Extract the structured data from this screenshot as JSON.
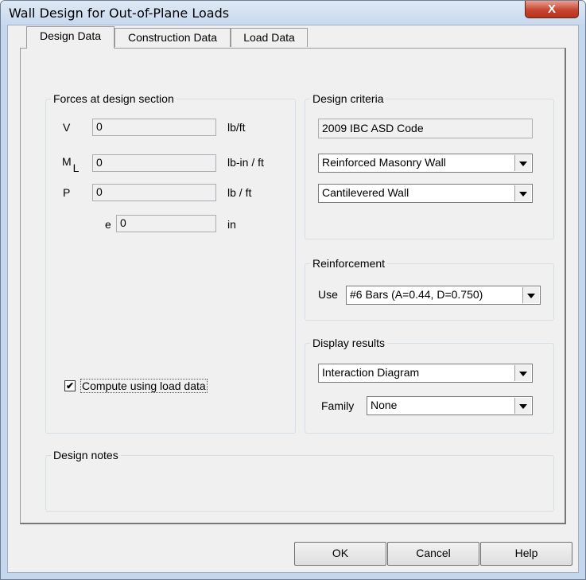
{
  "window": {
    "title": "Wall Design for Out-of-Plane Loads",
    "close_glyph": "X"
  },
  "tabs": [
    {
      "label": "Design Data",
      "active": true
    },
    {
      "label": "Construction Data",
      "active": false
    },
    {
      "label": "Load Data",
      "active": false
    }
  ],
  "forces": {
    "legend": "Forces at design section",
    "v": {
      "label": "V",
      "value": "0",
      "unit": "lb/ft"
    },
    "ml": {
      "label": "M",
      "sub": "L",
      "value": "0",
      "unit": "lb-in / ft"
    },
    "p": {
      "label": "P",
      "value": "0",
      "unit": "lb / ft"
    },
    "e": {
      "label": "e",
      "value": "0",
      "unit": "in"
    }
  },
  "compute": {
    "label": "Compute using load data",
    "checked": true,
    "mark": "✔"
  },
  "design_criteria": {
    "legend": "Design criteria",
    "code": "2009 IBC ASD Code",
    "wall_type": "Reinforced Masonry Wall",
    "support": "Cantilevered Wall"
  },
  "reinforcement": {
    "legend": "Reinforcement",
    "use_label": "Use",
    "bars": "#6 Bars (A=0.44, D=0.750)"
  },
  "display": {
    "legend": "Display results",
    "result": "Interaction Diagram",
    "family_label": "Family",
    "family": "None"
  },
  "notes": {
    "legend": "Design notes"
  },
  "buttons": {
    "ok": "OK",
    "cancel": "Cancel",
    "help": "Help"
  }
}
